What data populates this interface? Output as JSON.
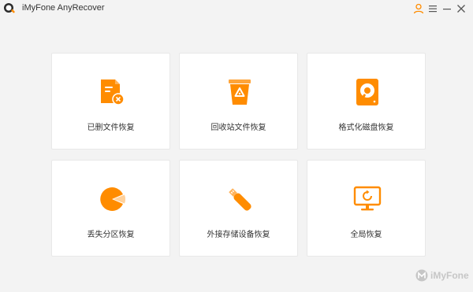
{
  "window": {
    "title": "iMyFone AnyRecover",
    "accent": "#ff8c00"
  },
  "titlebar": {
    "buttons": [
      {
        "name": "account",
        "icon": "user-icon"
      },
      {
        "name": "menu",
        "icon": "hamburger-menu-icon"
      },
      {
        "name": "minimize",
        "icon": "minimize-icon"
      },
      {
        "name": "close",
        "icon": "close-icon"
      }
    ]
  },
  "modes": [
    {
      "label": "已删文件恢复",
      "icon": "deleted-file-icon"
    },
    {
      "label": "回收站文件恢复",
      "icon": "recycle-bin-icon"
    },
    {
      "label": "格式化磁盘恢复",
      "icon": "formatted-disk-icon"
    },
    {
      "label": "丢失分区恢复",
      "icon": "lost-partition-icon"
    },
    {
      "label": "外接存储设备恢复",
      "icon": "usb-drive-icon"
    },
    {
      "label": "全局恢复",
      "icon": "monitor-refresh-icon"
    }
  ],
  "footer": {
    "brand": "iMyFone"
  }
}
